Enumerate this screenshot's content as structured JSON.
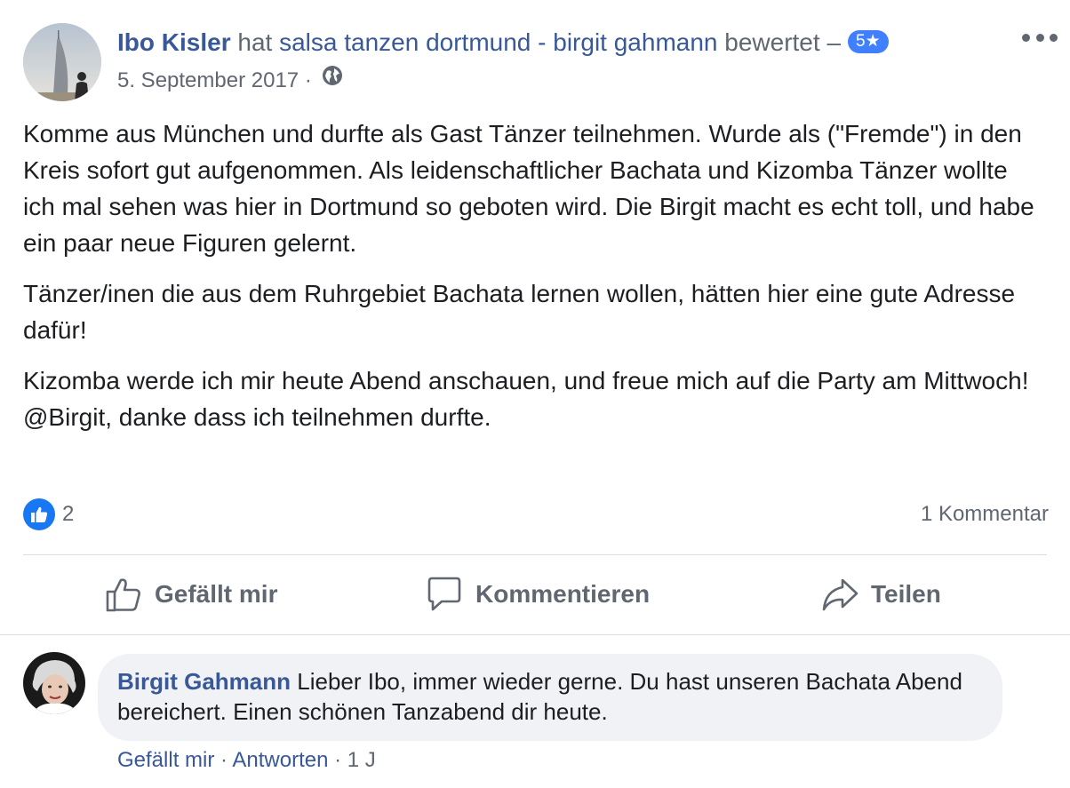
{
  "post": {
    "author": "Ibo Kisler",
    "action_text": "hat",
    "page_name": "salsa tanzen dortmund - birgit gahmann",
    "action_suffix": "bewertet –",
    "rating": "5★",
    "date": "5. September 2017",
    "separator": "·",
    "privacy_icon": "globe-icon",
    "paragraphs": [
      "Komme aus München und durfte als Gast Tänzer teilnehmen. Wurde als (\"Fremde\") in den Kreis sofort gut aufgenommen. Als leidenschaftlicher Bachata und Kizomba Tänzer wollte ich mal sehen was hier in Dortmund so geboten wird. Die Birgit macht es echt toll, und habe ein paar neue Figuren gelernt.",
      "Tänzer/inen die aus dem Ruhrgebiet Bachata lernen wollen, hätten hier eine gute Adresse dafür!"
    ],
    "last_paragraph_lines": [
      "Kizomba werde ich mir heute Abend anschauen, und freue mich auf die Party am Mittwoch!",
      "@Birgit, danke dass ich teilnehmen durfte."
    ]
  },
  "stats": {
    "like_count": "2",
    "comment_count": "1 Kommentar"
  },
  "actions": {
    "like": "Gefällt mir",
    "comment": "Kommentieren",
    "share": "Teilen"
  },
  "comment": {
    "author": "Birgit Gahmann",
    "text": "Lieber Ibo, immer wieder gerne. Du hast unseren Bachata Abend bereichert. Einen schönen Tanzabend dir heute.",
    "like_label": "Gefällt mir",
    "reply_label": "Antworten",
    "separator": "·",
    "age": "1 J"
  },
  "colors": {
    "link": "#385898",
    "badge": "#4080ff",
    "like": "#1877f2",
    "secondary_text": "#606770"
  }
}
